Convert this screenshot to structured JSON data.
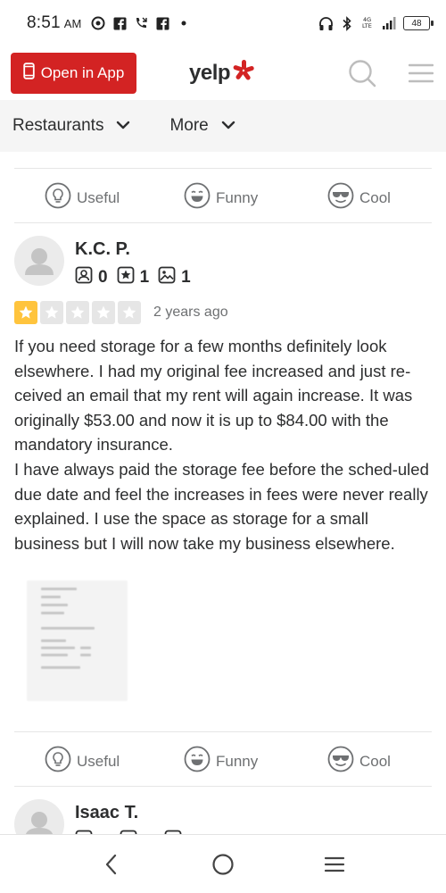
{
  "status_bar": {
    "time": "8:51",
    "ampm": "AM",
    "battery": "48",
    "network": "4G LTE"
  },
  "header": {
    "open_app_label": "Open in App",
    "logo_text": "yelp",
    "brand_color": "#d32323"
  },
  "nav": {
    "items": [
      {
        "label": "Restaurants",
        "icon": "chevron-down-icon"
      },
      {
        "label": "More",
        "icon": "chevron-down-icon"
      }
    ]
  },
  "reactions": {
    "useful": "Useful",
    "funny": "Funny",
    "cool": "Cool"
  },
  "review": {
    "user_name": "K.C. P.",
    "stats": {
      "friends": "0",
      "reviews": "1",
      "photos": "1"
    },
    "rating": 1,
    "rating_max": 5,
    "date": "2 years ago",
    "paragraphs": [
      "If you need storage for a few months definitely look elsewhere. I had my original fee increased and just re-ceived an email that my rent will again increase. It was originally $53.00 and now it is up to $84.00 with the mandatory insurance.",
      "I have always paid the storage fee before the sched-uled due date and feel the increases in fees were never really explained. I use the space as storage for a small business but I will now take my business elsewhere."
    ]
  },
  "next_review": {
    "user_name": "Isaac T."
  },
  "colors": {
    "star_on": "#ffc43d",
    "star_off": "#e6e6e6",
    "muted_text": "#6e7072"
  }
}
